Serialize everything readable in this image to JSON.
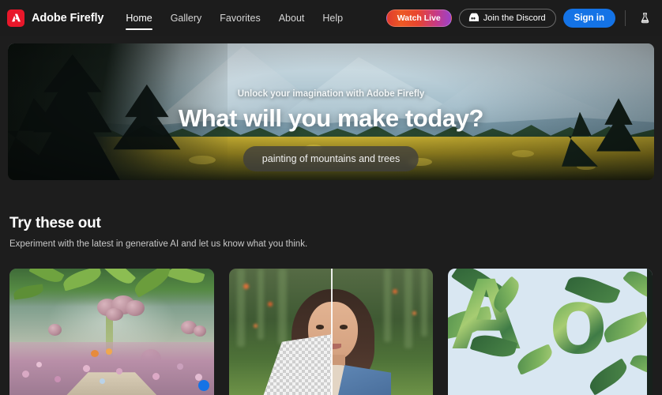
{
  "header": {
    "logo_icon": "adobe-logo-icon",
    "brand": "Adobe Firefly",
    "brand_color": "#e8172a",
    "nav": [
      {
        "label": "Home",
        "active": true
      },
      {
        "label": "Gallery",
        "active": false
      },
      {
        "label": "Favorites",
        "active": false
      },
      {
        "label": "About",
        "active": false
      },
      {
        "label": "Help",
        "active": false
      }
    ],
    "watch_live": "Watch Live",
    "discord_label": "Join the Discord",
    "discord_icon": "discord-icon",
    "sign_in": "Sign in",
    "beaker_icon": "beaker-icon",
    "signin_color": "#1473e6"
  },
  "hero": {
    "eyebrow": "Unlock your imagination with Adobe Firefly",
    "title": "What will you make today?",
    "prompt": "painting of mountains and trees"
  },
  "section": {
    "title": "Try these out",
    "subtitle": "Experiment with the latest in generative AI and let us know what you think."
  },
  "cards": [
    {
      "name": "fantasy-garden-card"
    },
    {
      "name": "portrait-background-card"
    },
    {
      "name": "leafy-text-effect-card"
    }
  ]
}
